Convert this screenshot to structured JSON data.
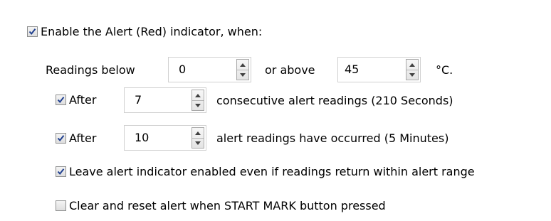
{
  "alert": {
    "enable_checked": true,
    "enable_label": "Enable the Alert (Red) indicator, when:",
    "readings_below_label": "Readings below",
    "below_value": "0",
    "or_above_label": "or above",
    "above_value": "45",
    "unit_label": "°C.",
    "after1_checked": true,
    "after1_label": "After",
    "after1_value": "7",
    "after1_suffix": "consecutive alert readings (210 Seconds)",
    "after2_checked": true,
    "after2_label": "After",
    "after2_value": "10",
    "after2_suffix": "alert readings have occurred (5 Minutes)",
    "leave_checked": true,
    "leave_label": "Leave alert indicator enabled even if readings return within alert range",
    "clear_checked": false,
    "clear_label": "Clear and reset alert when START MARK button pressed"
  }
}
